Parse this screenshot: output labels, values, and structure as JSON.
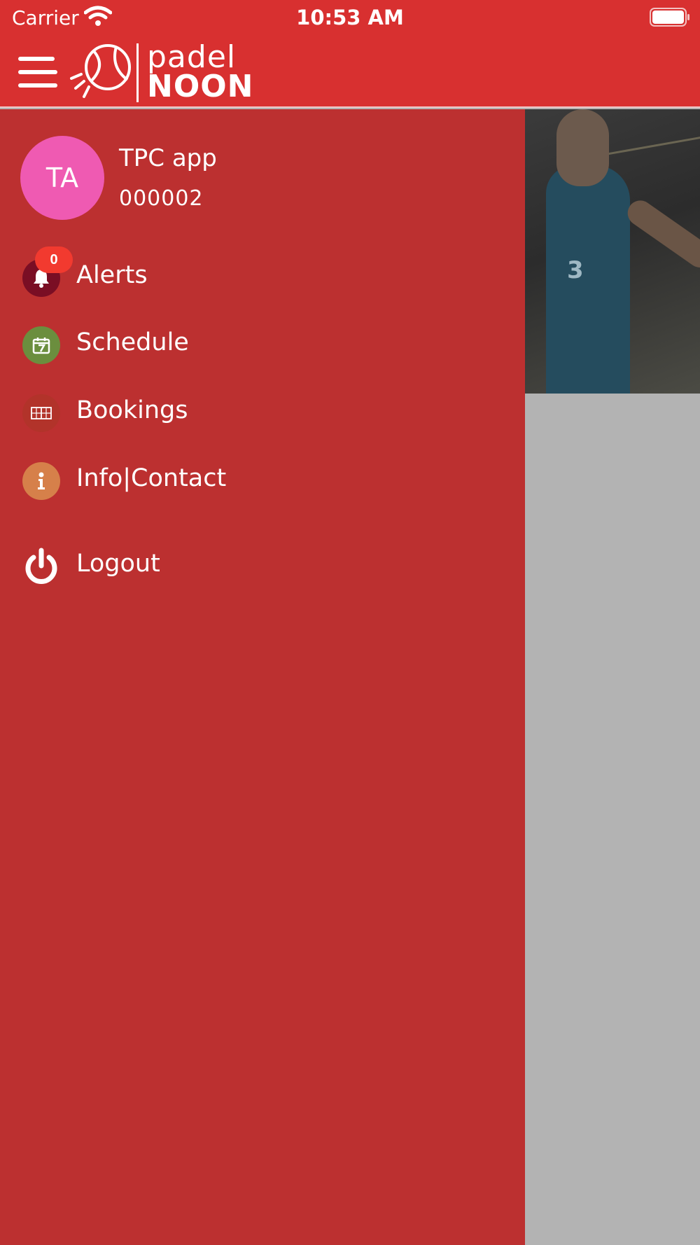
{
  "status_bar": {
    "carrier": "Carrier",
    "time": "10:53 AM"
  },
  "header": {
    "logo_line1": "padel",
    "logo_line2": "NOON"
  },
  "profile": {
    "initials": "TA",
    "name": "TPC app",
    "id": "000002",
    "avatar_color": "#ef5ab2"
  },
  "menu": {
    "items": [
      {
        "label": "Alerts",
        "icon": "bell-icon",
        "color": "#7a0e24",
        "badge": "0"
      },
      {
        "label": "Schedule",
        "icon": "calendar-icon",
        "color": "#6b8e3e"
      },
      {
        "label": "Bookings",
        "icon": "court-icon",
        "color": "#b2332a"
      },
      {
        "label": "Info|Contact",
        "icon": "info-icon",
        "color": "#d6804a"
      },
      {
        "label": "Logout",
        "icon": "power-icon",
        "color": "#bc3030"
      }
    ]
  },
  "hero": {
    "jersey_number": "3"
  },
  "colors": {
    "header": "#d83030",
    "drawer": "#bc3030",
    "badge": "#f23a2f",
    "backdrop": "#b3b3b3"
  }
}
